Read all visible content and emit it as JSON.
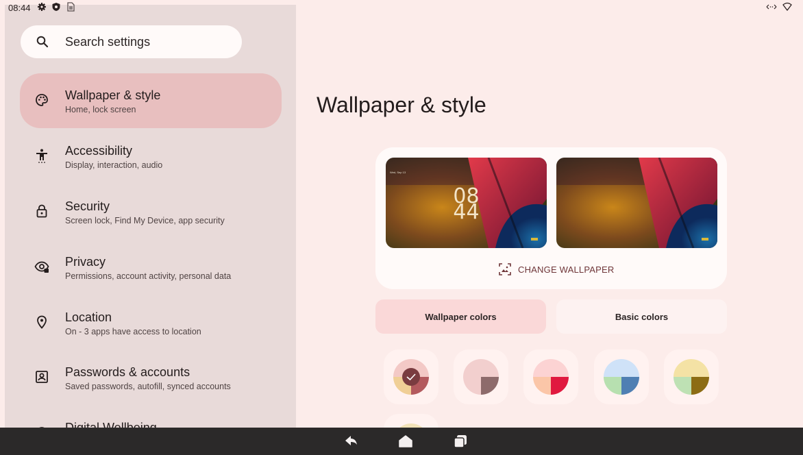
{
  "status_bar": {
    "time": "08:44",
    "icons": [
      "gear-icon",
      "shield-icon",
      "sim-icon",
      "arrows-icon",
      "wifi-icon"
    ]
  },
  "search": {
    "label": "Search settings"
  },
  "menu": {
    "items": [
      {
        "title": "Wallpaper & style",
        "subtitle": "Home, lock screen",
        "icon": "palette-icon",
        "selected": true
      },
      {
        "title": "Accessibility",
        "subtitle": "Display, interaction, audio",
        "icon": "accessibility-icon"
      },
      {
        "title": "Security",
        "subtitle": "Screen lock, Find My Device, app security",
        "icon": "lock-icon"
      },
      {
        "title": "Privacy",
        "subtitle": "Permissions, account activity, personal data",
        "icon": "privacy-eye-icon"
      },
      {
        "title": "Location",
        "subtitle": "On - 3 apps have access to location",
        "icon": "location-pin-icon"
      },
      {
        "title": "Passwords & accounts",
        "subtitle": "Saved passwords, autofill, synced accounts",
        "icon": "account-box-icon"
      },
      {
        "title": "Digital Wellbeing",
        "subtitle": "",
        "icon": "wellbeing-icon"
      }
    ]
  },
  "main": {
    "title": "Wallpaper & style",
    "lock_preview": {
      "hour": "08",
      "minute": "44",
      "date": "Wed, Sep 13"
    },
    "change_wallpaper": "CHANGE WALLPAPER",
    "tabs": [
      {
        "label": "Wallpaper colors",
        "selected": true
      },
      {
        "label": "Basic colors",
        "selected": false
      }
    ],
    "swatches": [
      {
        "top": "#f3c9c6",
        "bottom_left": "#f0cf96",
        "bottom_right": "#b35a5e",
        "selected": true
      },
      {
        "top": "#f2cfce",
        "bottom_left": "#f2cfce",
        "bottom_right": "#8d6b6b",
        "selected": false
      },
      {
        "top": "#fcd3d3",
        "bottom_left": "#fbc6a8",
        "bottom_right": "#e0193f",
        "selected": false
      },
      {
        "top": "#cfe2f8",
        "bottom_left": "#b7e0b0",
        "bottom_right": "#4f7fb3",
        "selected": false
      },
      {
        "top": "#f4e2a5",
        "bottom_left": "#bee1b4",
        "bottom_right": "#8c6c14",
        "selected": false
      },
      {
        "top": "#f2e2b8",
        "bottom_left": "#f2e2b8",
        "bottom_right": "#f2e2b8",
        "selected": false
      }
    ],
    "accent_color": "#6e3538"
  },
  "nav_bar": {
    "buttons": [
      "back-icon",
      "home-icon",
      "recents-icon"
    ]
  }
}
